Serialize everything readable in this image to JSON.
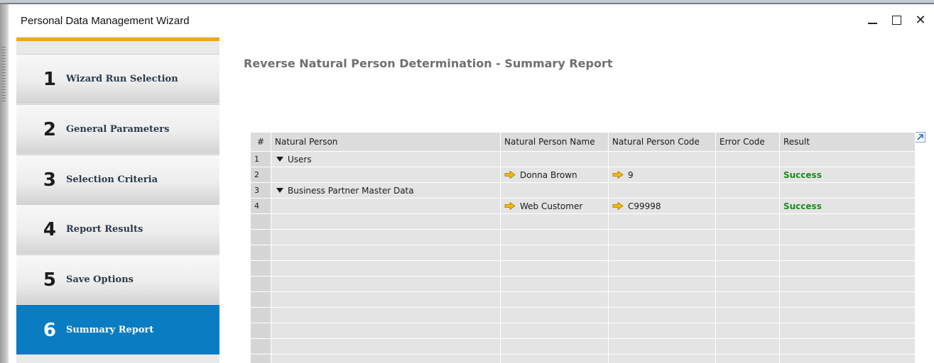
{
  "window": {
    "title": "Personal Data Management Wizard"
  },
  "steps": [
    {
      "num": "1",
      "label": "Wizard Run Selection",
      "active": false
    },
    {
      "num": "2",
      "label": "General Parameters",
      "active": false
    },
    {
      "num": "3",
      "label": "Selection Criteria",
      "active": false
    },
    {
      "num": "4",
      "label": "Report Results",
      "active": false
    },
    {
      "num": "5",
      "label": "Save Options",
      "active": false
    },
    {
      "num": "6",
      "label": "Summary Report",
      "active": true
    }
  ],
  "main": {
    "heading": "Reverse Natural Person Determination - Summary Report"
  },
  "grid": {
    "columns": [
      "#",
      "Natural Person",
      "Natural Person Name",
      "Natural Person Code",
      "Error Code",
      "Result"
    ],
    "rows": [
      {
        "num": "1",
        "group": "Users",
        "name": "",
        "code": "",
        "error": "",
        "result": ""
      },
      {
        "num": "2",
        "group": "",
        "name": "Donna Brown",
        "code": "9",
        "error": "",
        "result": "Success"
      },
      {
        "num": "3",
        "group": "Business Partner Master Data",
        "name": "",
        "code": "",
        "error": "",
        "result": ""
      },
      {
        "num": "4",
        "group": "",
        "name": "Web Customer",
        "code": "C99998",
        "error": "",
        "result": "Success"
      }
    ]
  },
  "colors": {
    "accent": "#0a7cc1",
    "step_bar": "#f0a818",
    "success": "#1e8a1e",
    "link_arrow": "#f5b800"
  }
}
